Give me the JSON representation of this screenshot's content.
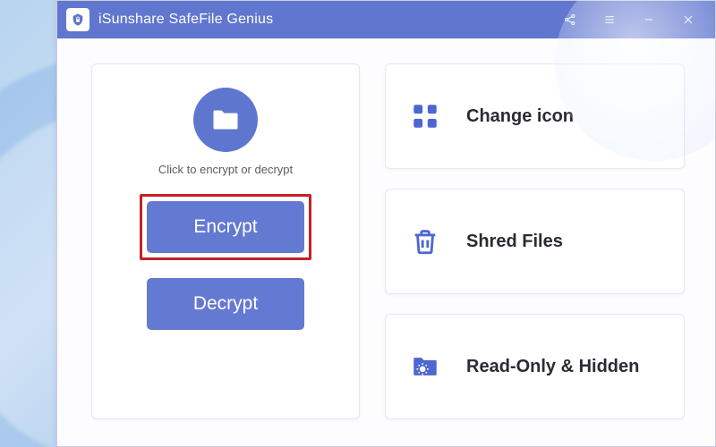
{
  "titlebar": {
    "title": "iSunshare SafeFile Genius"
  },
  "main": {
    "hint": "Click to encrypt or decrypt",
    "encrypt_label": "Encrypt",
    "decrypt_label": "Decrypt"
  },
  "features": {
    "change_icon": "Change icon",
    "shred_files": "Shred Files",
    "readonly_hidden": "Read-Only & Hidden"
  },
  "colors": {
    "accent": "#6176cf",
    "button": "#6479d1",
    "highlight": "#c62023"
  }
}
